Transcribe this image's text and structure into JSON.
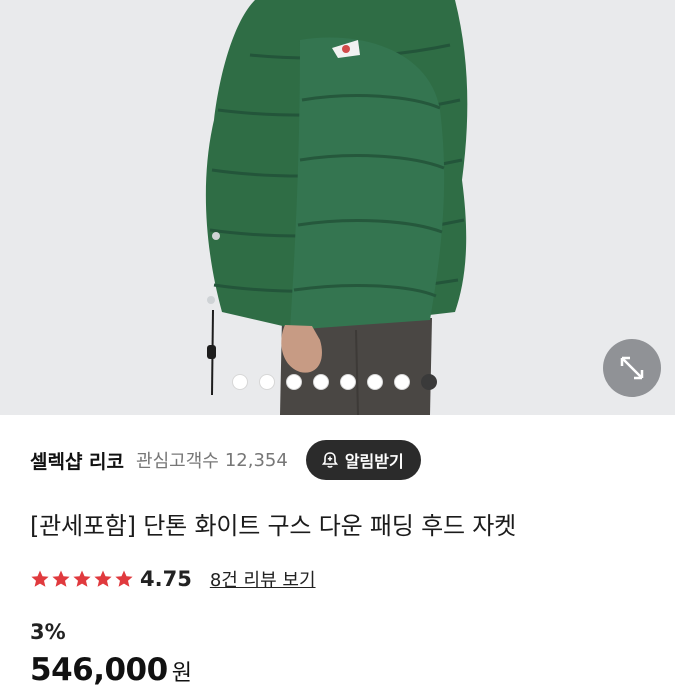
{
  "gallery": {
    "image_alt": "green down puffer jacket",
    "dot_count": 8,
    "active_dot": 7,
    "expand_icon": "expand-arrows-icon"
  },
  "shop": {
    "name": "셀렉샵 리코",
    "favorites_label": "관심고객수",
    "favorites_count": "12,354",
    "notify_label": "알림받기",
    "notify_icon": "bell-plus-icon"
  },
  "product": {
    "title": "[관세포함] 단톤 화이트 구스 다운 패딩 후드 자켓",
    "rating": "4.75",
    "stars": 5,
    "review_link": "8건 리뷰 보기",
    "discount": "3%",
    "price": "546,000",
    "currency": "원"
  },
  "colors": {
    "star": "#e03a3e",
    "jacket": "#2f6d45",
    "notify_bg": "#2b2b2b"
  }
}
